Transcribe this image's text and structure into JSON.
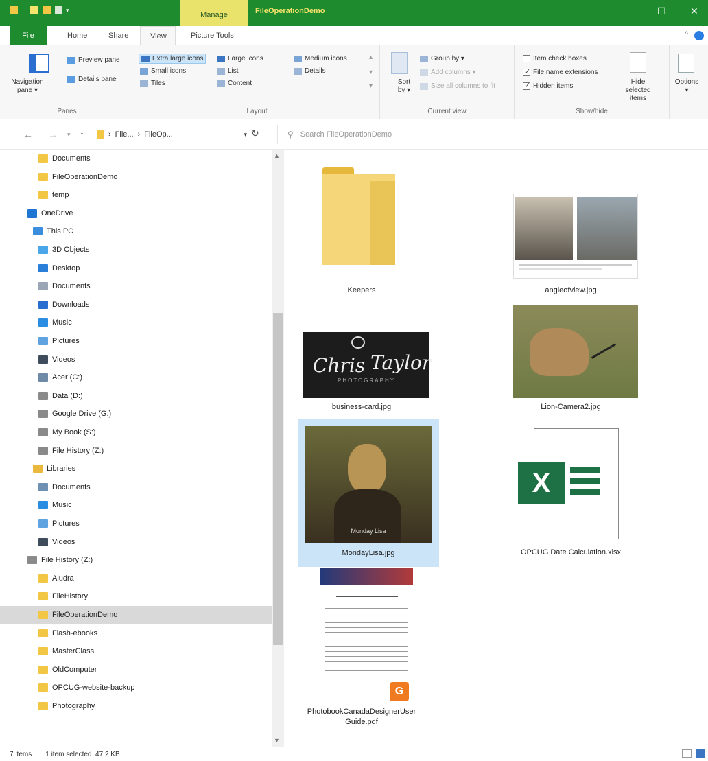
{
  "titlebar": {
    "manage_tab": "Manage",
    "window_title": "FileOperationDemo",
    "minimize": "—",
    "maximize": "☐",
    "close": "✕"
  },
  "ribbon_tabs": {
    "file": "File",
    "home": "Home",
    "share": "Share",
    "view": "View",
    "picture_tools": "Picture Tools"
  },
  "ribbon": {
    "panes": {
      "navigation_pane": "Navigation pane ▾",
      "preview_pane": "Preview pane",
      "details_pane": "Details pane",
      "label": "Panes"
    },
    "layout": {
      "extra_large_icons": "Extra large icons",
      "large_icons": "Large icons",
      "medium_icons": "Medium icons",
      "small_icons": "Small icons",
      "list": "List",
      "details": "Details",
      "tiles": "Tiles",
      "content": "Content",
      "label": "Layout"
    },
    "current_view": {
      "sort_by": "Sort by ▾",
      "group_by": "Group by ▾",
      "add_columns": "Add columns ▾",
      "size_all_columns": "Size all columns to fit",
      "label": "Current view"
    },
    "show_hide": {
      "item_check_boxes": "Item check boxes",
      "file_name_extensions": "File name extensions",
      "hidden_items": "Hidden items",
      "hide_selected_items": "Hide selected items",
      "label": "Show/hide"
    },
    "options": "Options ▾"
  },
  "address": {
    "path_part1": "File...",
    "path_part2": "FileOp...",
    "search_placeholder": "Search FileOperationDemo"
  },
  "sidebar": {
    "items": [
      {
        "label": "Documents",
        "icon": "folder-icon",
        "color": "#f2c746"
      },
      {
        "label": "FileOperationDemo",
        "icon": "folder-icon",
        "color": "#f2c746"
      },
      {
        "label": "temp",
        "icon": "folder-icon",
        "color": "#f2c746"
      },
      {
        "label": "OneDrive",
        "icon": "cloud-icon",
        "color": "#1f76d2"
      },
      {
        "label": "This PC",
        "icon": "computer-icon",
        "color": "#3b8ede"
      },
      {
        "label": "3D Objects",
        "icon": "cube-icon",
        "color": "#4aa6e8"
      },
      {
        "label": "Desktop",
        "icon": "desktop-icon",
        "color": "#2b7fd8"
      },
      {
        "label": "Documents",
        "icon": "document-icon",
        "color": "#9aa6b6"
      },
      {
        "label": "Downloads",
        "icon": "download-icon",
        "color": "#2a6fcf"
      },
      {
        "label": "Music",
        "icon": "music-icon",
        "color": "#2b8de1"
      },
      {
        "label": "Pictures",
        "icon": "pictures-icon",
        "color": "#5fa4e0"
      },
      {
        "label": "Videos",
        "icon": "videos-icon",
        "color": "#3e4c5c"
      },
      {
        "label": "Acer (C:)",
        "icon": "drive-icon",
        "color": "#6e8aa6"
      },
      {
        "label": "Data (D:)",
        "icon": "drive-icon",
        "color": "#8a8a8a"
      },
      {
        "label": "Google Drive (G:)",
        "icon": "drive-icon",
        "color": "#8a8a8a"
      },
      {
        "label": "My Book (S:)",
        "icon": "drive-icon",
        "color": "#8a8a8a"
      },
      {
        "label": "File History (Z:)",
        "icon": "drive-icon",
        "color": "#8a8a8a"
      },
      {
        "label": "Libraries",
        "icon": "libraries-icon",
        "color": "#e9b83d"
      },
      {
        "label": "Documents",
        "icon": "document-icon",
        "color": "#6f8fb3"
      },
      {
        "label": "Music",
        "icon": "music-icon",
        "color": "#2b8de1"
      },
      {
        "label": "Pictures",
        "icon": "pictures-icon",
        "color": "#5fa4e0"
      },
      {
        "label": "Videos",
        "icon": "videos-icon",
        "color": "#3e4c5c"
      },
      {
        "label": "File History (Z:)",
        "icon": "drive-icon",
        "color": "#8a8a8a"
      },
      {
        "label": "Aludra",
        "icon": "folder-icon",
        "color": "#f2c746"
      },
      {
        "label": "FileHistory",
        "icon": "folder-icon",
        "color": "#f2c746"
      },
      {
        "label": "FileOperationDemo",
        "icon": "folder-icon",
        "color": "#f2c746"
      },
      {
        "label": "Flash-ebooks",
        "icon": "folder-icon",
        "color": "#f2c746"
      },
      {
        "label": "MasterClass",
        "icon": "folder-icon",
        "color": "#f2c746"
      },
      {
        "label": "OldComputer",
        "icon": "folder-icon",
        "color": "#f2c746"
      },
      {
        "label": "OPCUG-website-backup",
        "icon": "folder-icon",
        "color": "#f2c746"
      },
      {
        "label": "Photography",
        "icon": "folder-icon",
        "color": "#f2c746"
      }
    ]
  },
  "files": {
    "keepers": "Keepers",
    "angleofview": "angleofview.jpg",
    "business_card": "business-card.jpg",
    "business_card_line1": "Chris",
    "business_card_line2": "Taylor",
    "business_card_line3": "PHOTOGRAPHY",
    "lion": "Lion-Camera2.jpg",
    "mondaylisa": "MondayLisa.jpg",
    "mondaylisa_caption": "Monday Lisa",
    "opcug": "OPCUG Date Calculation.xlsx",
    "photobook": "PhotobookCanadaDesignerUser Guide.pdf"
  },
  "status": {
    "items": "7 items",
    "selected": "1 item selected  47.2 KB"
  },
  "colors": {
    "title_green": "#1e8b2e",
    "manage_yellow": "#e9e26b",
    "selection_blue": "#cce4f7",
    "folder_yellow": "#f2c746",
    "excel_green": "#1e7145"
  }
}
